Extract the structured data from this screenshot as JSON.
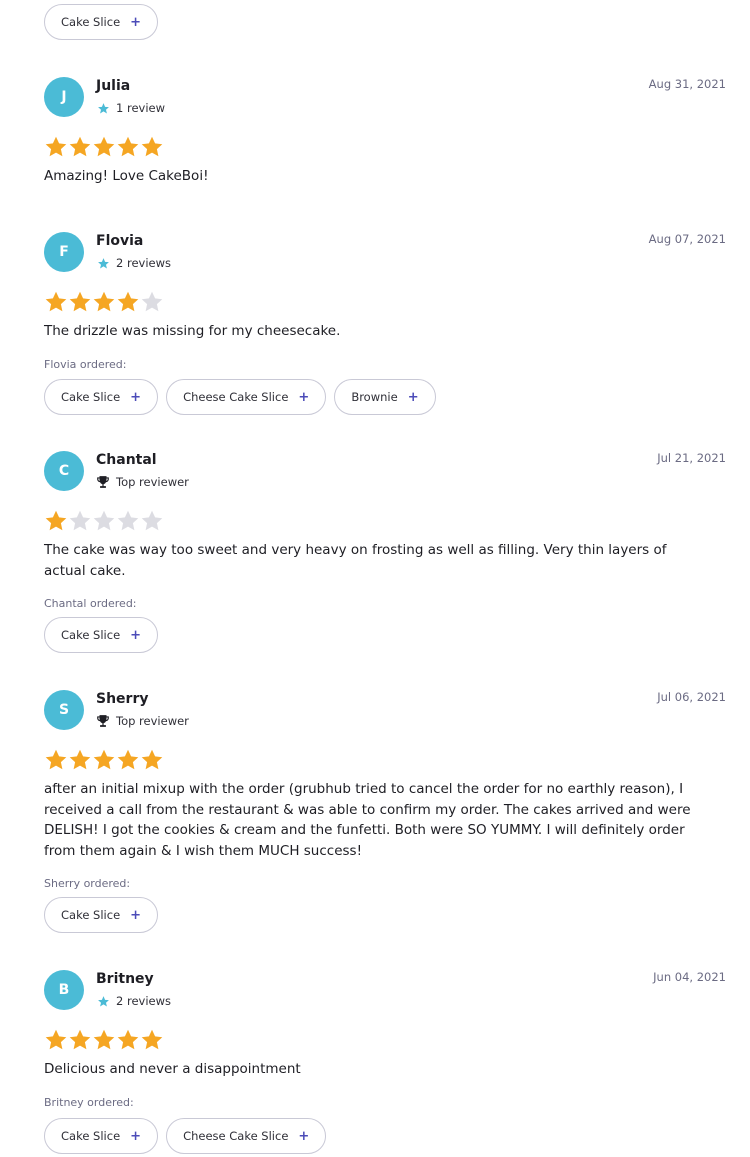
{
  "top_chips": [
    "Cake Slice"
  ],
  "reviews": [
    {
      "initial": "J",
      "name": "Julia",
      "meta_type": "star",
      "meta": "1 review",
      "date": "Aug 31, 2021",
      "rating": 5,
      "text": "Amazing! Love CakeBoi!",
      "ordered_label": "",
      "ordered": []
    },
    {
      "initial": "F",
      "name": "Flovia",
      "meta_type": "star",
      "meta": "2 reviews",
      "date": "Aug 07, 2021",
      "rating": 4,
      "text": "The drizzle was missing for my cheesecake.",
      "ordered_label": "Flovia ordered:",
      "ordered": [
        "Cake Slice",
        "Cheese Cake Slice",
        "Brownie"
      ]
    },
    {
      "initial": "C",
      "name": "Chantal",
      "meta_type": "trophy",
      "meta": "Top reviewer",
      "date": "Jul 21, 2021",
      "rating": 1,
      "text": "The cake was way too sweet and very heavy on frosting as well as filling. Very thin layers of actual cake.",
      "ordered_label": "Chantal ordered:",
      "ordered": [
        "Cake Slice"
      ]
    },
    {
      "initial": "S",
      "name": "Sherry",
      "meta_type": "trophy",
      "meta": "Top reviewer",
      "date": "Jul 06, 2021",
      "rating": 5,
      "text": "after an initial mixup with the order (grubhub tried to cancel the order for no earthly reason), I received a call from the restaurant & was able to confirm my order. The cakes arrived and were DELISH! I got the cookies & cream and the funfetti. Both were SO YUMMY. I will definitely order from them again & I wish them MUCH success!",
      "ordered_label": "Sherry ordered:",
      "ordered": [
        "Cake Slice"
      ]
    },
    {
      "initial": "B",
      "name": "Britney",
      "meta_type": "star",
      "meta": "2 reviews",
      "date": "Jun 04, 2021",
      "rating": 5,
      "text": "Delicious and never a disappointment",
      "ordered_label": "Britney ordered:",
      "ordered": [
        "Cake Slice",
        "Cheese Cake Slice"
      ]
    }
  ],
  "colors": {
    "avatar": "#4bbbd6",
    "star_on": "#f5a623",
    "star_off": "#dcdce2",
    "accent": "#4b4bb8"
  }
}
